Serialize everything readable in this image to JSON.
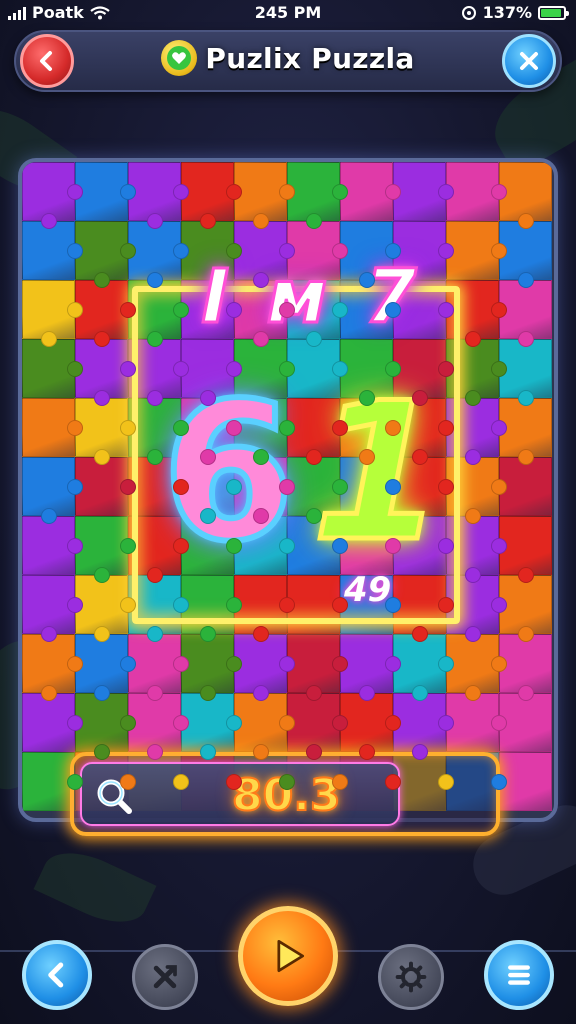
{
  "status_bar": {
    "carrier": "Poatk",
    "time": "245 PM",
    "battery_text": "137%",
    "battery_level": 0.9,
    "icons": [
      "signal-icon",
      "wifi-icon",
      "alarm-icon",
      "battery-icon"
    ]
  },
  "header": {
    "title": "Puzlix Puzzla",
    "back_icon": "chevron-left-icon",
    "close_icon": "close-icon",
    "badge_icon": "heart-badge-icon"
  },
  "board": {
    "grid_cols": 10,
    "grid_rows": 11,
    "piece_colors": [
      "#e2261f",
      "#1f7de0",
      "#2bb33b",
      "#f2c21a",
      "#9b2de0",
      "#f07a16",
      "#e03aa8",
      "#18b7c8",
      "#c81e3c",
      "#4a8c1f"
    ],
    "overlay_letters": "I ᴍ 7",
    "overlay_digit_left": "6",
    "overlay_digit_right": "1",
    "overlay_small_number": "49"
  },
  "score_bar": {
    "search_icon": "search-icon",
    "value": "80.3"
  },
  "bottom_nav": {
    "items": [
      {
        "name": "back",
        "icon": "chevron-left-icon"
      },
      {
        "name": "shuffle",
        "icon": "shuffle-icon"
      },
      {
        "name": "play",
        "icon": "play-icon"
      },
      {
        "name": "settings",
        "icon": "gear-icon"
      },
      {
        "name": "menu",
        "icon": "menu-icon"
      }
    ]
  }
}
